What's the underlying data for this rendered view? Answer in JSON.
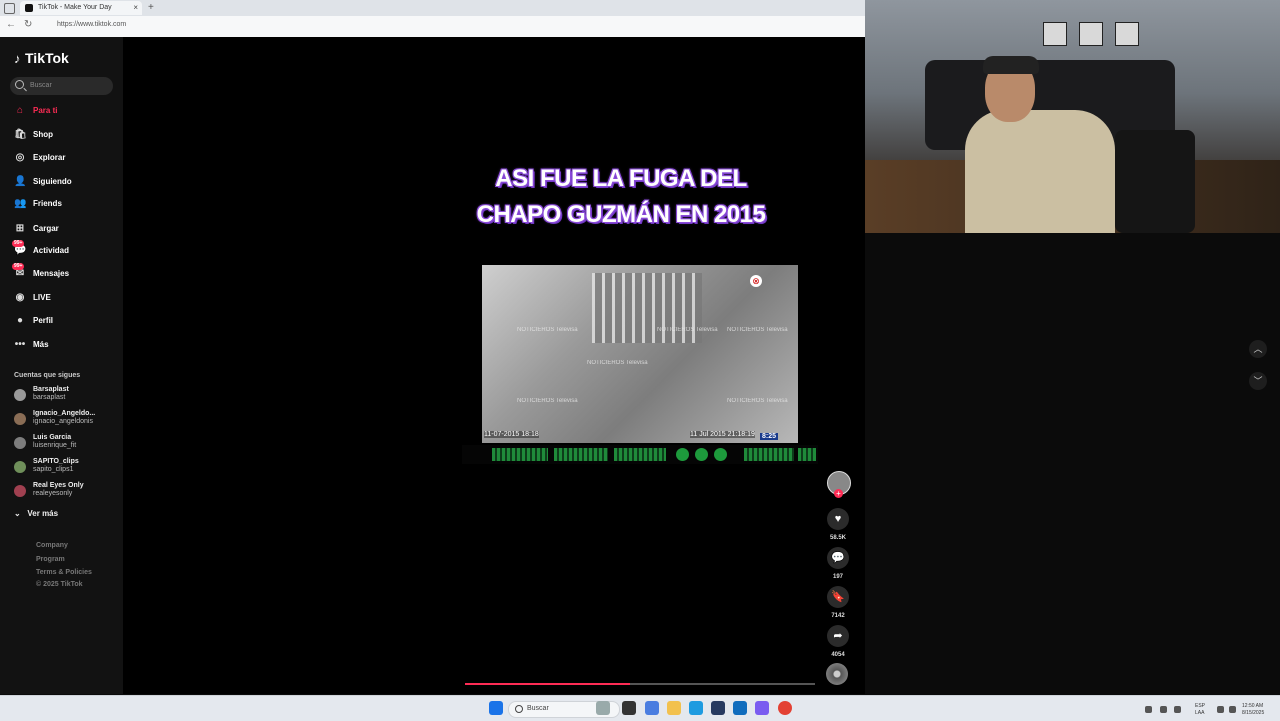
{
  "browser": {
    "tab_title": "TikTok - Make Your Day",
    "tab_close": "×",
    "new_tab": "+",
    "url": "https://www.tiktok.com",
    "back": "←",
    "reload": "↻"
  },
  "sidebar": {
    "logo": "TikTok",
    "search_placeholder": "Buscar",
    "menu": [
      {
        "label": "Para ti",
        "icon": "⌂",
        "active": true
      },
      {
        "label": "Shop",
        "icon": "🛍"
      },
      {
        "label": "Explorar",
        "icon": "◎"
      },
      {
        "label": "Siguiendo",
        "icon": "👤"
      },
      {
        "label": "Friends",
        "icon": "👥"
      },
      {
        "label": "Cargar",
        "icon": "⊞"
      },
      {
        "label": "Actividad",
        "icon": "💬",
        "badge": "99+"
      },
      {
        "label": "Mensajes",
        "icon": "✉",
        "badge": "99+"
      },
      {
        "label": "LIVE",
        "icon": "◉"
      },
      {
        "label": "Perfil",
        "icon": "●"
      },
      {
        "label": "Más",
        "icon": "•••"
      }
    ],
    "following_title": "Cuentas que sigues",
    "accounts": [
      {
        "name": "Barsaplast",
        "handle": "barsaplast"
      },
      {
        "name": "Ignacio_Angeldo...",
        "handle": "ignacio_angeldonis"
      },
      {
        "name": "Luis Garcia",
        "handle": "luisenrique_fit"
      },
      {
        "name": "SAPITO_clips",
        "handle": "sapito_clips1"
      },
      {
        "name": "Real Eyes Only",
        "handle": "realeyesonly"
      }
    ],
    "see_more": "Ver más",
    "footer": [
      "Company",
      "Program",
      "Terms & Policies",
      "© 2025 TikTok"
    ]
  },
  "video": {
    "title_line1": "ASI FUE LA FUGA DEL",
    "title_line2": "CHAPO GUZMÁN EN 2015",
    "watermark": "NOTICIEROS Televisa",
    "timestamp_left": "11-07-2015 18:18",
    "timestamp_right": "11 Jul 2015 21:18:19",
    "timestamp_badge": "8:25",
    "progress": 0.47
  },
  "actions": {
    "plus": "+",
    "likes": "58.5K",
    "comments": "197",
    "saves": "7142",
    "shares": "4054",
    "like_icon": "♥",
    "comment_icon": "💬",
    "save_icon": "🔖",
    "share_icon": "➦"
  },
  "nav_controls": {
    "up": "︿",
    "down": "﹀"
  },
  "taskbar": {
    "search_placeholder": "Buscar",
    "lang": "ESP",
    "lang2": "LAA",
    "time": "12:50 AM",
    "date": "8/15/2025"
  }
}
